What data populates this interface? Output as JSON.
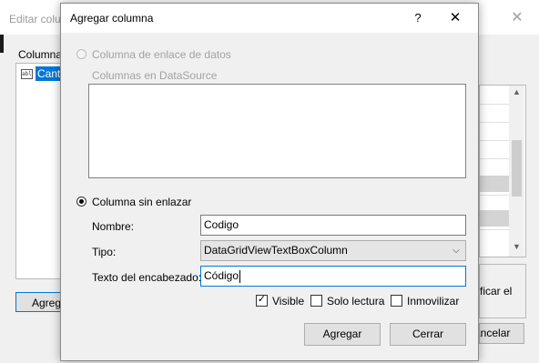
{
  "background_window": {
    "title": "Editar colu",
    "columns_label": "Columna",
    "list_item_icon": "abl",
    "list_item": "Cant",
    "add_button_label": "Agreg",
    "property_text": "ficar el",
    "cancel_button_label": "ancelar"
  },
  "dialog": {
    "title": "Agregar columna",
    "help_label": "?",
    "close_label": "✕",
    "radio_databound_label": "Columna de enlace de datos",
    "datasource_columns_label": "Columnas en DataSource",
    "radio_unbound_label": "Columna sin enlazar",
    "name_label": "Nombre:",
    "name_value": "Codigo",
    "type_label": "Tipo:",
    "type_value": "DataGridViewTextBoxColumn",
    "header_label": "Texto del encabezado:",
    "header_value": "Código",
    "visible_label": "Visible",
    "visible_checked": true,
    "readonly_label": "Solo lectura",
    "readonly_checked": false,
    "frozen_label": "Inmovilizar",
    "frozen_checked": false,
    "add_button_label": "Agregar",
    "cancel_button_label": "Cerrar"
  },
  "colors": {
    "accent": "#0078d7",
    "disabled_text": "#a2a2a2"
  },
  "icons": {
    "close": "close-icon",
    "help": "help-icon",
    "dropdown": "chevron-down-icon",
    "check": "check-icon"
  }
}
